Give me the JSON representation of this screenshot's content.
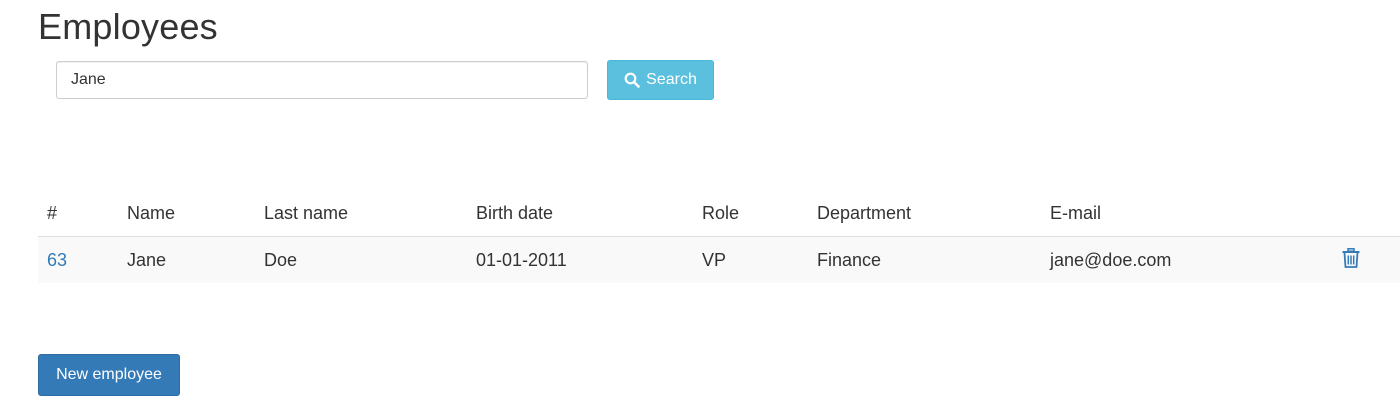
{
  "page": {
    "title": "Employees"
  },
  "search": {
    "value": "Jane",
    "button_label": "Search",
    "button_icon": "search-icon",
    "button_color": "#5bc0de"
  },
  "table": {
    "headers": [
      "#",
      "Name",
      "Last name",
      "Birth date",
      "Role",
      "Department",
      "E-mail"
    ],
    "rows": [
      {
        "id": "63",
        "name": "Jane",
        "last_name": "Doe",
        "birth_date": "01-01-2011",
        "role": "VP",
        "department": "Finance",
        "email": "jane@doe.com",
        "action_icon": "trash-icon"
      }
    ]
  },
  "actions": {
    "new_label": "New employee",
    "new_color": "#337ab7"
  }
}
